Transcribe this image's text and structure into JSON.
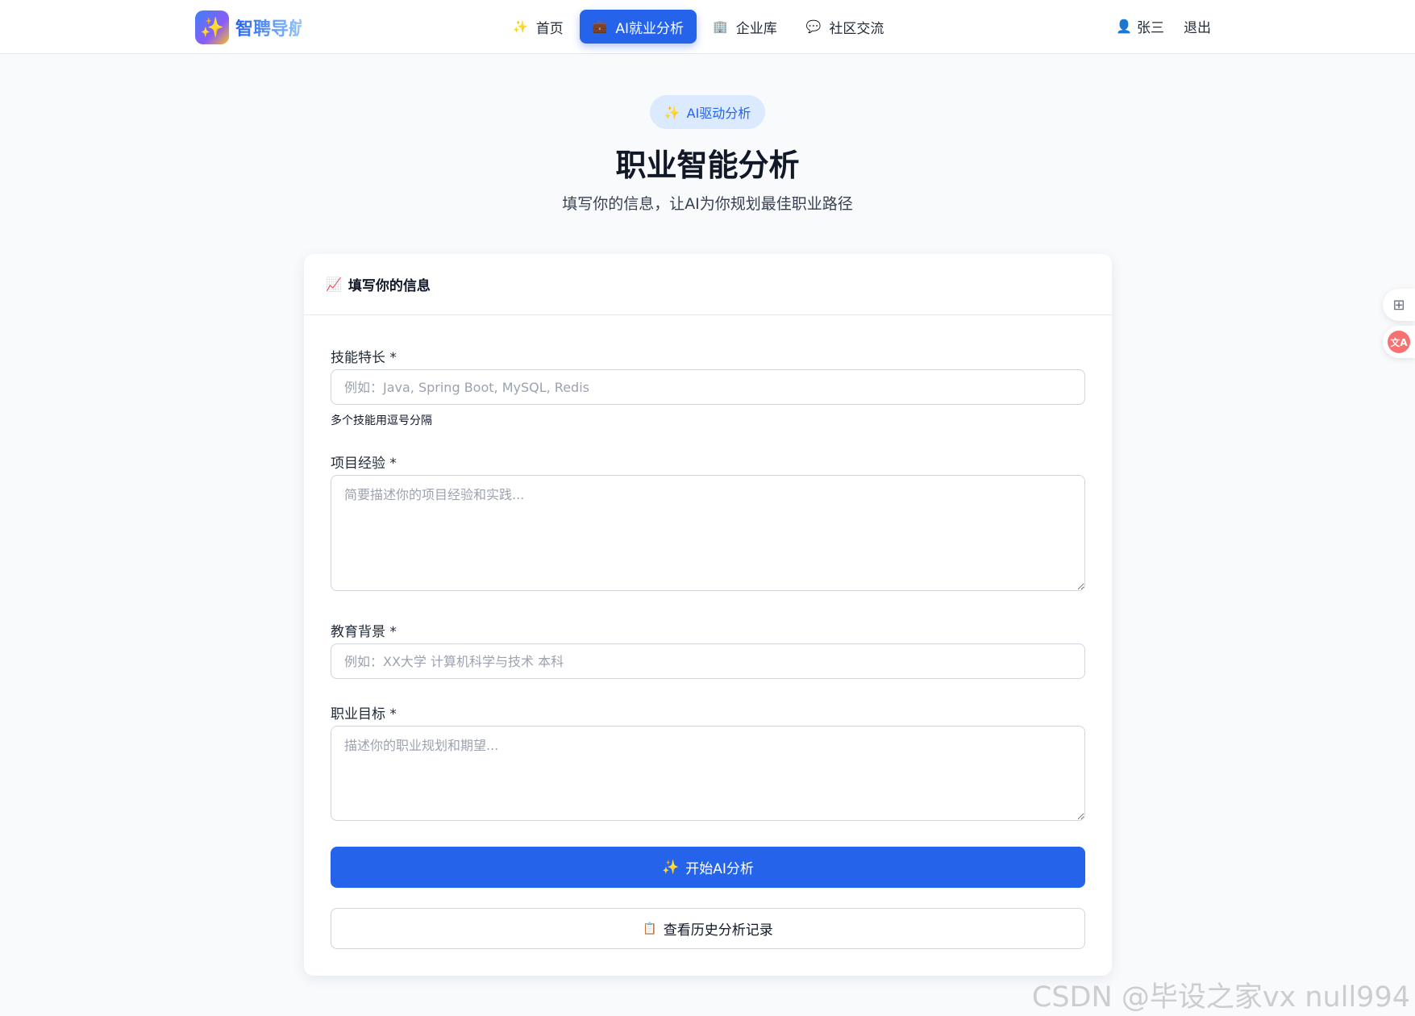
{
  "brand": {
    "name": "智聘导航",
    "icon": "sparkle-icon"
  },
  "nav": {
    "items": [
      {
        "label": "首页",
        "icon": "sparkle-icon",
        "active": false
      },
      {
        "label": "AI就业分析",
        "icon": "briefcase-icon",
        "active": true
      },
      {
        "label": "企业库",
        "icon": "building-icon",
        "active": false
      },
      {
        "label": "社区交流",
        "icon": "chat-bubble-icon",
        "active": false
      }
    ]
  },
  "user": {
    "name": "张三",
    "logout": "退出",
    "icon": "user-icon"
  },
  "hero": {
    "badge": "AI驱动分析",
    "title": "职业智能分析",
    "subtitle": "填写你的信息，让AI为你规划最佳职业路径"
  },
  "card": {
    "title": "填写你的信息",
    "icon": "chart-icon",
    "fields": {
      "skills": {
        "label": "技能特长 *",
        "placeholder": "例如：Java, Spring Boot, MySQL, Redis",
        "value": "",
        "hint": "多个技能用逗号分隔"
      },
      "projects": {
        "label": "项目经验 *",
        "placeholder": "简要描述你的项目经验和实践...",
        "value": ""
      },
      "education": {
        "label": "教育背景 *",
        "placeholder": "例如：XX大学 计算机科学与技术 本科",
        "value": ""
      },
      "goal": {
        "label": "职业目标 *",
        "placeholder": "描述你的职业规划和期望...",
        "value": ""
      }
    },
    "submit_label": "开始AI分析",
    "history_label": "查看历史分析记录"
  },
  "colors": {
    "accent": "#2563eb",
    "background": "#f8fafc",
    "card": "#ffffff"
  },
  "watermark": "CSDN @毕设之家vx null994"
}
